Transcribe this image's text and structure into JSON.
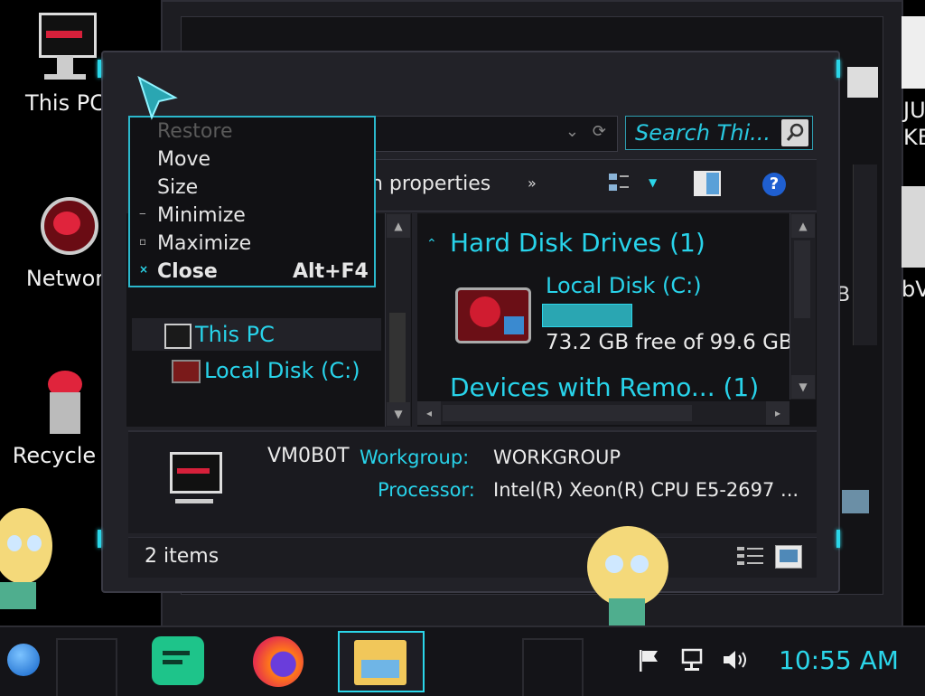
{
  "desktop": {
    "icons": [
      {
        "label": "This PC",
        "icon": "alienware-monitor-icon"
      },
      {
        "label": "Networ",
        "icon": "network-icon"
      },
      {
        "label": "Recycle B",
        "icon": "recycle-bin-icon"
      }
    ],
    "right_labels": [
      "JU",
      "KE",
      "bV"
    ],
    "partial_text": "B"
  },
  "window": {
    "search_placeholder": "Search Thi...",
    "toolbar": {
      "properties_label": "n properties",
      "more_label": "»"
    },
    "nav": {
      "items": [
        {
          "label": "This PC",
          "icon": "this-pc-icon"
        },
        {
          "label": "Local Disk (C:)",
          "icon": "local-disk-icon"
        }
      ]
    },
    "content": {
      "section1": "Hard Disk Drives (1)",
      "drive": {
        "name": "Local Disk (C:)",
        "free_text": "73.2 GB free of 99.6 GB",
        "used_fraction": 0.265
      },
      "section2": "Devices with Remo...   (1)"
    },
    "details": {
      "computer_name": "VM0B0T",
      "workgroup_label": "Workgroup:",
      "workgroup_value": "WORKGROUP",
      "processor_label": "Processor:",
      "processor_value": "Intel(R) Xeon(R) CPU E5-2697 ..."
    },
    "status": {
      "items_count": "2 items"
    }
  },
  "context_menu": {
    "items": [
      {
        "label": "Restore",
        "enabled": false,
        "glyph": ""
      },
      {
        "label": "Move",
        "enabled": true,
        "glyph": ""
      },
      {
        "label": "Size",
        "enabled": true,
        "glyph": ""
      },
      {
        "label": "Minimize",
        "enabled": true,
        "glyph": "‒"
      },
      {
        "label": "Maximize",
        "enabled": true,
        "glyph": "▫"
      },
      {
        "label": "Close",
        "enabled": true,
        "glyph": "×",
        "shortcut": "Alt+F4"
      }
    ]
  },
  "taskbar": {
    "clock": "10:55 AM",
    "apps": [
      "start-orb-icon",
      "notes-app-icon",
      "firefox-icon",
      "file-explorer-icon"
    ],
    "tray": [
      "flag-icon",
      "network-tray-icon",
      "volume-icon"
    ]
  },
  "colors": {
    "accent": "#28d3ea",
    "bg": "#000000",
    "panel": "#131316"
  }
}
